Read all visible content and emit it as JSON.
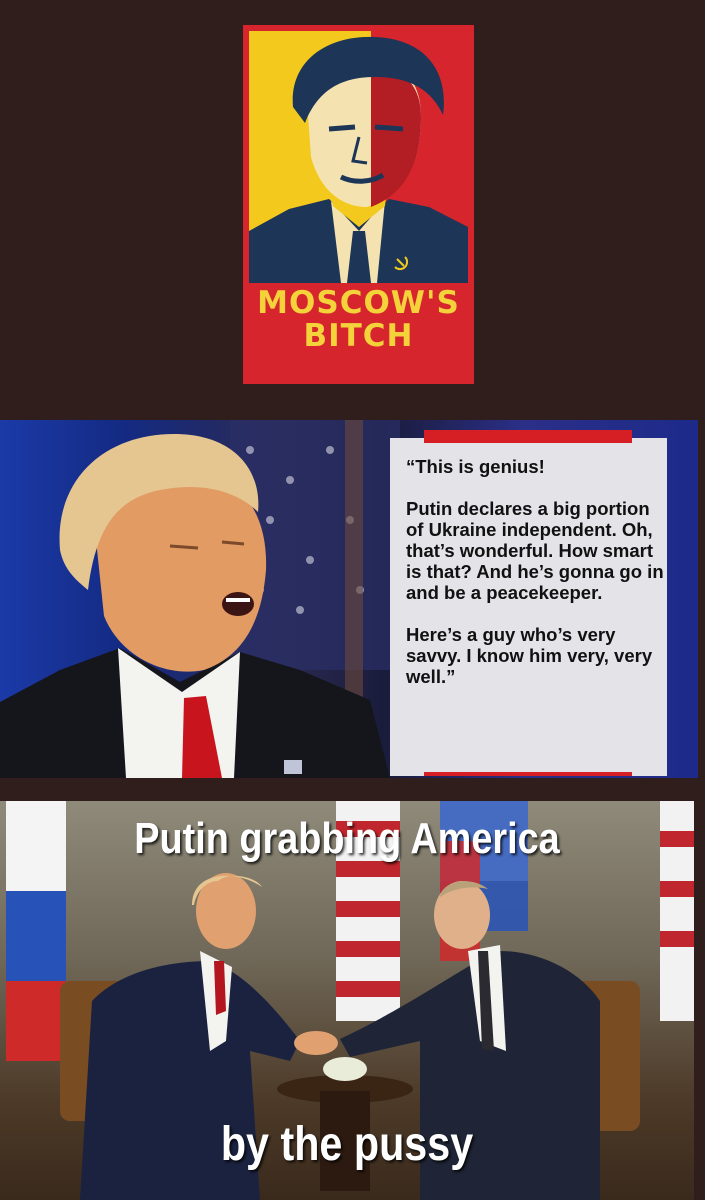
{
  "poster": {
    "caption_line1": "MOSCOW'S",
    "caption_line2": "BITCH",
    "emblem_icon": "hammer-and-sickle-icon",
    "colors": {
      "red": "#d6252d",
      "yellow": "#f2c91c",
      "navy": "#1d3557",
      "cream": "#f4e3b0"
    }
  },
  "quote": {
    "line1": "“This is genius!",
    "para2": "Putin declares a big portion of Ukraine independent. Oh, that’s wonderful. How smart is that? And he’s gonna go in and be a peacekeeper.",
    "para3": "Here’s a guy who’s very savvy. I know him very, very well.”",
    "accent_color": "#d51f25"
  },
  "meme": {
    "top_text": "Putin grabbing America",
    "bottom_text": "by the pussy"
  }
}
